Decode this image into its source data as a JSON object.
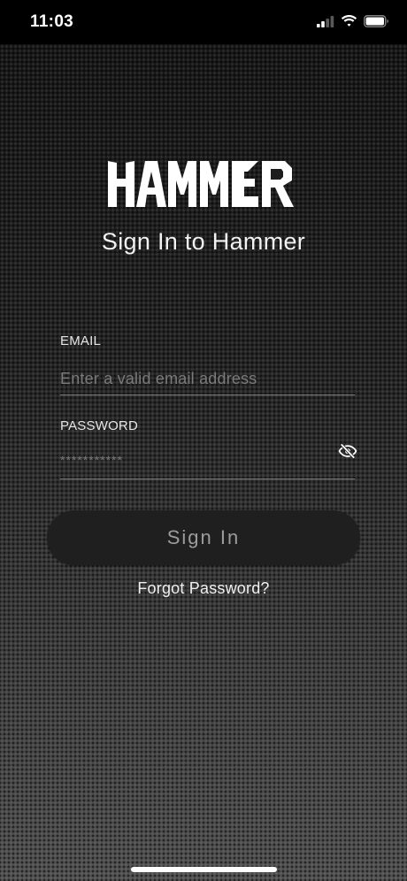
{
  "status_bar": {
    "time": "11:03",
    "icons": [
      "cellular-signal-icon",
      "wifi-icon",
      "battery-icon"
    ]
  },
  "logo": {
    "text": "HAMMER"
  },
  "title": "Sign In to Hammer",
  "form": {
    "email": {
      "label": "EMAIL",
      "placeholder": "Enter a valid email address",
      "value": ""
    },
    "password": {
      "label": "PASSWORD",
      "placeholder": "***********",
      "value": "",
      "toggle_icon": "eye-slash-icon"
    },
    "submit_label": "Sign In",
    "forgot_label": "Forgot Password?"
  },
  "colors": {
    "background_top": "#151515",
    "background_bottom": "#4f4f4f",
    "button_bg": "#1f1f1f",
    "button_text": "#9c9c9c",
    "text": "#f2f2f2",
    "placeholder": "#7a7a7a"
  }
}
